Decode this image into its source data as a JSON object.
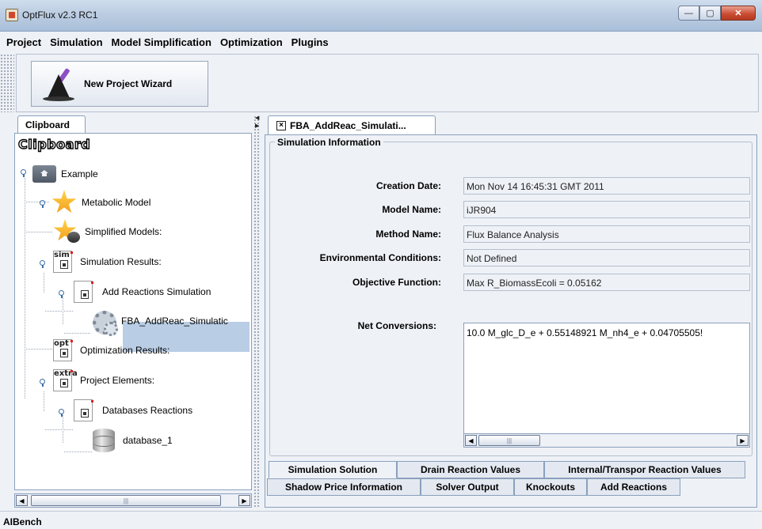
{
  "window": {
    "title": "OptFlux v2.3 RC1",
    "minimize": "—",
    "maximize": "▢",
    "close": "✕"
  },
  "menu": [
    "Project",
    "Simulation",
    "Model Simplification",
    "Optimization",
    "Plugins"
  ],
  "toolbar": {
    "wizard_label": "New Project Wizard"
  },
  "clipboard": {
    "tab_label": "Clipboard",
    "title": "Clipboard",
    "nodes": {
      "example": "Example",
      "metabolic_model": "Metabolic Model",
      "simplified_models": "Simplified Models:",
      "simulation_results": "Simulation Results:",
      "add_reactions_simulation": "Add Reactions Simulation",
      "fba_item": "FBA_AddReac_Simulatic",
      "optimization_results": "Optimization Results:",
      "project_elements": "Project Elements:",
      "databases_reactions": "Databases Reactions",
      "database_1": "database_1"
    },
    "icon_tags": {
      "sim": "sim",
      "opt": "opt",
      "extra": "extra"
    }
  },
  "document": {
    "tab_label": "FBA_AddReac_Simulati...",
    "group_title": "Simulation Information",
    "fields": [
      {
        "label": "Creation Date:",
        "value": "Mon Nov 14 16:45:31 GMT 2011"
      },
      {
        "label": "Model Name:",
        "value": "iJR904"
      },
      {
        "label": "Method Name:",
        "value": "Flux Balance Analysis"
      },
      {
        "label": "Environmental Conditions:",
        "value": "Not Defined"
      },
      {
        "label": "Objective Function:",
        "value": "Max R_BiomassEcoli  = 0.05162"
      }
    ],
    "net_conversions_label": "Net Conversions:",
    "net_conversions_value": "10.0 M_glc_D_e + 0.55148921 M_nh4_e + 0.04705505!"
  },
  "bottom_tabs": {
    "row1": [
      "Simulation Solution",
      "Drain Reaction Values",
      "Internal/Transpor Reaction Values"
    ],
    "row2": [
      "Shadow Price Information",
      "Solver Output",
      "Knockouts",
      "Add Reactions"
    ],
    "active": "Simulation Solution"
  },
  "scroll_glyphs": {
    "left": "◀",
    "right": "▶",
    "grip": "|||"
  },
  "status": {
    "text": "AIBench"
  }
}
